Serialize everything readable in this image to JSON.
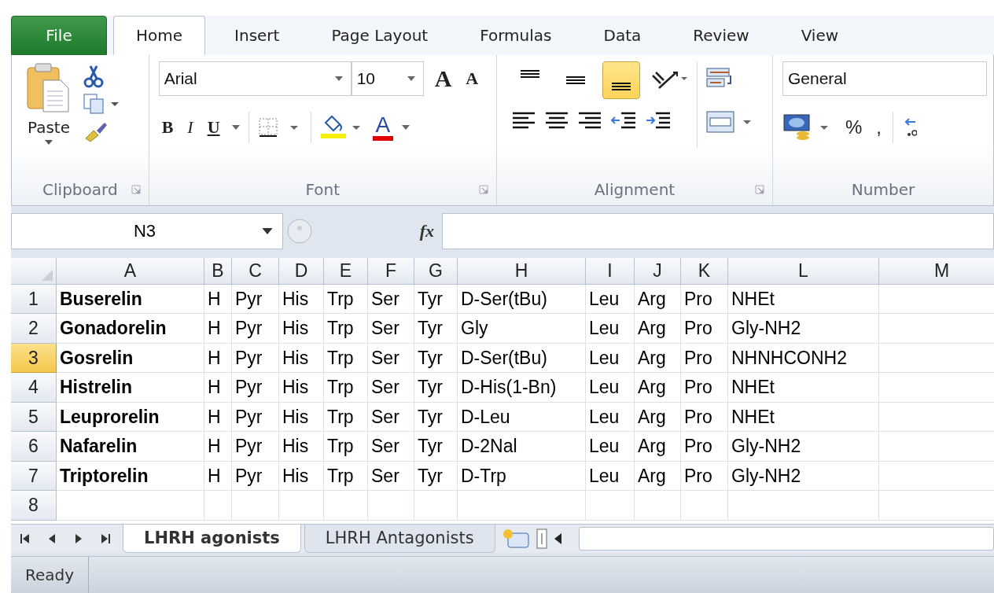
{
  "menu_tabs": [
    {
      "label": "File",
      "kind": "file",
      "selected": false
    },
    {
      "label": "Home",
      "kind": "tab",
      "selected": true
    },
    {
      "label": "Insert",
      "kind": "tab",
      "selected": false
    },
    {
      "label": "Page Layout",
      "kind": "tab",
      "selected": false
    },
    {
      "label": "Formulas",
      "kind": "tab",
      "selected": false
    },
    {
      "label": "Data",
      "kind": "tab",
      "selected": false
    },
    {
      "label": "Review",
      "kind": "tab",
      "selected": false
    },
    {
      "label": "View",
      "kind": "tab",
      "selected": false
    }
  ],
  "clipboard": {
    "paste": "Paste",
    "label": "Clipboard"
  },
  "font": {
    "name": "Arial",
    "size": "10",
    "grow": "A",
    "shrink": "A",
    "bold": "B",
    "italic": "I",
    "underline": "U",
    "color_letter": "A",
    "label": "Font"
  },
  "alignment": {
    "vertical": [
      {
        "kind": "top",
        "selected": false
      },
      {
        "kind": "middle",
        "selected": false
      },
      {
        "kind": "bottom",
        "selected": true
      }
    ],
    "label": "Alignment"
  },
  "number": {
    "format": "General",
    "percent": "%",
    "comma": ",",
    "label": "Number"
  },
  "formula_bar": {
    "name_box": "N3",
    "function_label": "fx"
  },
  "sheet": {
    "columns": [
      "A",
      "B",
      "C",
      "D",
      "E",
      "F",
      "G",
      "H",
      "I",
      "J",
      "K",
      "L",
      "M"
    ],
    "rows": [
      {
        "number": "1",
        "selected": false,
        "cells": [
          "Buserelin",
          "H",
          "Pyr",
          "His",
          "Trp",
          "Ser",
          "Tyr",
          "D-Ser(tBu)",
          "Leu",
          "Arg",
          "Pro",
          "NHEt"
        ]
      },
      {
        "number": "2",
        "selected": false,
        "cells": [
          "Gonadorelin",
          "H",
          "Pyr",
          "His",
          "Trp",
          "Ser",
          "Tyr",
          "Gly",
          "Leu",
          "Arg",
          "Pro",
          "Gly-NH2"
        ]
      },
      {
        "number": "3",
        "selected": true,
        "cells": [
          "Gosrelin",
          "H",
          "Pyr",
          "His",
          "Trp",
          "Ser",
          "Tyr",
          "D-Ser(tBu)",
          "Leu",
          "Arg",
          "Pro",
          "NHNHCONH2"
        ]
      },
      {
        "number": "4",
        "selected": false,
        "cells": [
          "Histrelin",
          "H",
          "Pyr",
          "His",
          "Trp",
          "Ser",
          "Tyr",
          "D-His(1-Bn)",
          "Leu",
          "Arg",
          "Pro",
          "NHEt"
        ]
      },
      {
        "number": "5",
        "selected": false,
        "cells": [
          "Leuprorelin",
          "H",
          "Pyr",
          "His",
          "Trp",
          "Ser",
          "Tyr",
          "D-Leu",
          "Leu",
          "Arg",
          "Pro",
          "NHEt"
        ]
      },
      {
        "number": "6",
        "selected": false,
        "cells": [
          "Nafarelin",
          "H",
          "Pyr",
          "His",
          "Trp",
          "Ser",
          "Tyr",
          "D-2Nal",
          "Leu",
          "Arg",
          "Pro",
          "Gly-NH2"
        ]
      },
      {
        "number": "7",
        "selected": false,
        "cells": [
          "Triptorelin",
          "H",
          "Pyr",
          "His",
          "Trp",
          "Ser",
          "Tyr",
          "D-Trp",
          "Leu",
          "Arg",
          "Pro",
          "Gly-NH2"
        ]
      },
      {
        "number": "8",
        "selected": false,
        "cells": []
      }
    ]
  },
  "sheet_tabs": [
    {
      "label": "LHRH agonists",
      "selected": true
    },
    {
      "label": "LHRH Antagonists",
      "selected": false
    }
  ],
  "status_bar": {
    "text": "Ready"
  }
}
